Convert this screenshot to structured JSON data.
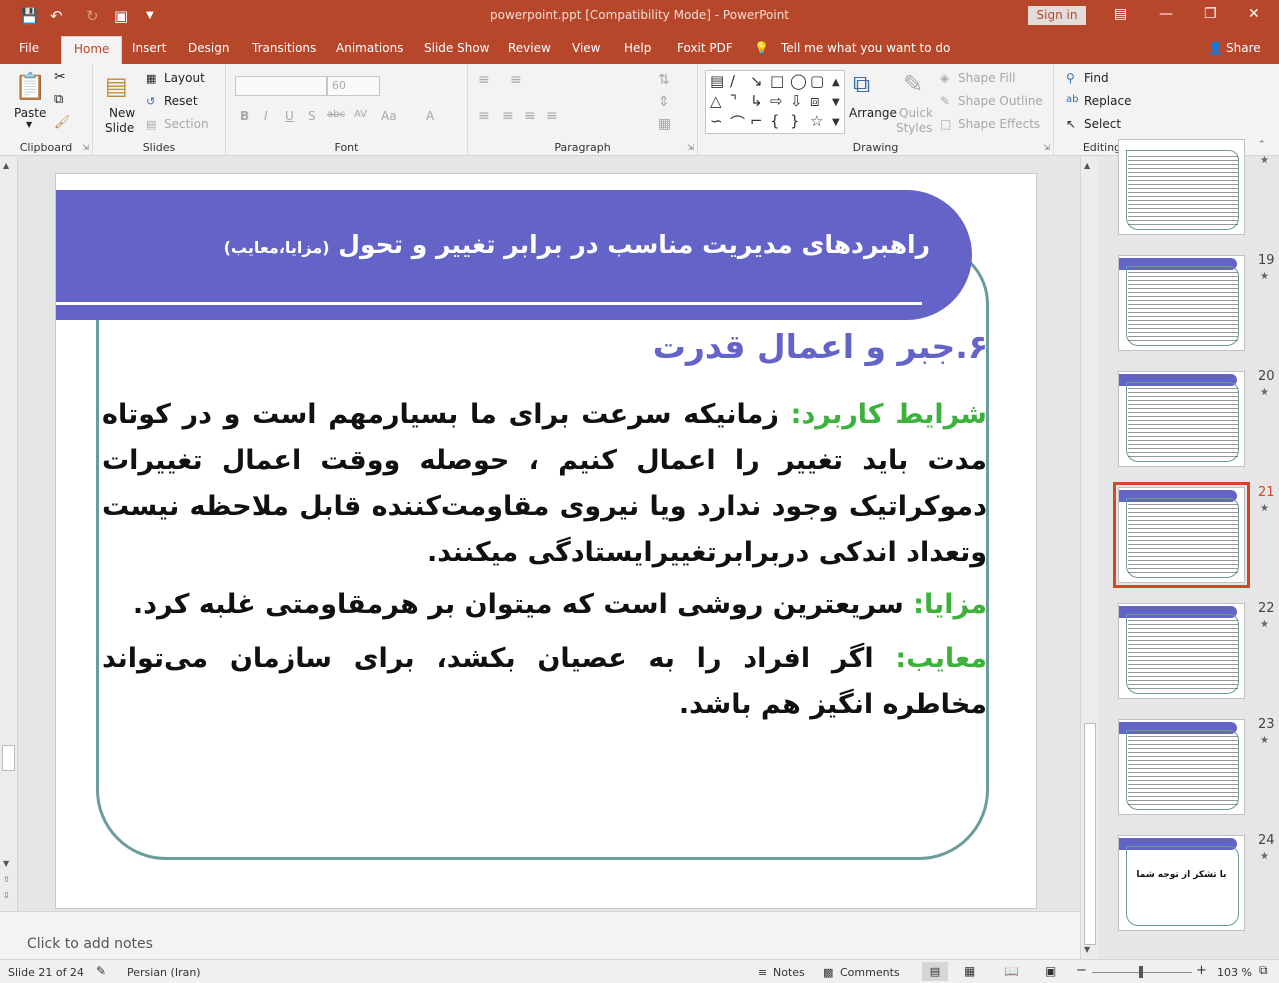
{
  "window": {
    "title": "powerpoint.ppt [Compatibility Mode]  -  PowerPoint",
    "sign_in": "Sign in"
  },
  "tabs": [
    "File",
    "Home",
    "Insert",
    "Design",
    "Transitions",
    "Animations",
    "Slide Show",
    "Review",
    "View",
    "Help",
    "Foxit PDF"
  ],
  "tell_me": "Tell me what you want to do",
  "share": "Share",
  "ribbon": {
    "clipboard": {
      "label": "Clipboard",
      "paste": "Paste"
    },
    "slides": {
      "label": "Slides",
      "new_slide_line1": "New",
      "new_slide_line2": "Slide",
      "layout": "Layout",
      "reset": "Reset",
      "section": "Section"
    },
    "font": {
      "label": "Font",
      "size": "60",
      "bold": "B",
      "italic": "I",
      "underline": "U",
      "shadow": "S",
      "strike": "abc",
      "spacing": "AV",
      "case": "Aa",
      "color": "A"
    },
    "paragraph": {
      "label": "Paragraph"
    },
    "drawing": {
      "label": "Drawing",
      "arrange": "Arrange",
      "quick_styles_line1": "Quick",
      "quick_styles_line2": "Styles",
      "shape_fill": "Shape Fill",
      "shape_outline": "Shape Outline",
      "shape_effects": "Shape Effects"
    },
    "editing": {
      "label": "Editing",
      "find": "Find",
      "replace": "Replace",
      "select": "Select"
    }
  },
  "slide": {
    "title": "راهبردهای مدیریت مناسب در برابر تغییر و تحول",
    "title_sub": "(مزایا،معایب)",
    "heading": "۶.جبر و اعمال قدرت",
    "p1_label": "شرایط کاربرد: ",
    "p1_text": "زمانیکه سرعت برای ما بسیارمهم است و در کوتاه مدت باید تغییر را اعمال کنیم ، حوصله ووقت اعمال تغییرات دموکراتیک وجود ندارد ویا نیروی مقاومت‌کننده قابل ملاحظه نیست وتعداد اندکی دربرابرتغییرایستادگی میکنند.",
    "p2_label": "مزایا: ",
    "p2_text": "سریعترین روشی است که میتوان بر هرمقاومتی غلبه کرد.",
    "p3_label": "معایب: ",
    "p3_text": "اگر افراد را به عصیان بکشد، برای سازمان می‌تواند مخاطره انگیز هم باشد."
  },
  "thumbnails": [
    {
      "num": "",
      "type": "text"
    },
    {
      "num": "19",
      "type": "text"
    },
    {
      "num": "20",
      "type": "text"
    },
    {
      "num": "21",
      "type": "text",
      "selected": true
    },
    {
      "num": "22",
      "type": "text"
    },
    {
      "num": "23",
      "type": "text"
    },
    {
      "num": "24",
      "type": "end",
      "text": "با تشکر از توجه شما"
    }
  ],
  "notes_placeholder": "Click to add notes",
  "status": {
    "slide": "Slide 21 of 24",
    "language": "Persian (Iran)",
    "notes": "Notes",
    "comments": "Comments",
    "zoom": "103 %"
  },
  "colors": {
    "accent": "#b7472a",
    "banner": "#6464c8",
    "label_green": "#3cb23c",
    "frame": "#6b9c9c"
  }
}
